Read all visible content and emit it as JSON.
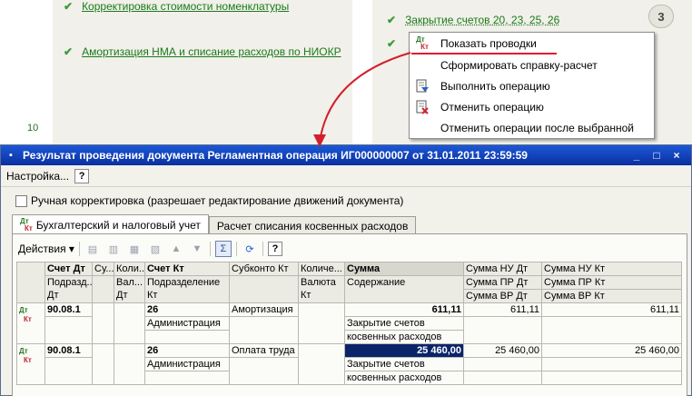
{
  "background": {
    "left_ops": [
      "Корректировка стоимости номенклатуры",
      "Амортизация НМА и списание расходов по НИОКР"
    ],
    "right_op": "Закрытие счетов 20, 23, 25, 26",
    "step_number": "3",
    "row_number": "10"
  },
  "context_menu": {
    "items": [
      {
        "label": "Показать проводки",
        "icon": "dt-kt-icon"
      },
      {
        "label": "Сформировать справку-расчет",
        "icon": ""
      },
      {
        "label": "Выполнить операцию",
        "icon": "execute-operation-icon"
      },
      {
        "label": "Отменить операцию",
        "icon": "cancel-operation-icon"
      },
      {
        "label": "Отменить операции после выбранной",
        "icon": ""
      }
    ],
    "accent": "#e0182d"
  },
  "window": {
    "title": "Результат проведения документа Регламентная операция ИГ000000007 от 31.01.2011 23:59:59",
    "settings_label": "Настройка...",
    "help_label": "?",
    "manual_adjust_label": "Ручная корректировка (разрешает редактирование движений документа)",
    "tabs": [
      "Бухгалтерский и налоговый учет",
      "Расчет списания косвенных расходов"
    ],
    "actions_label": "Действия",
    "title_buttons": [
      "_",
      "□",
      "×"
    ]
  },
  "grid": {
    "header_row1": [
      "Счет Дт",
      "Су...",
      "Коли...",
      "Счет Кт",
      "Субконто Кт",
      "Количе...",
      "Сумма",
      "Сумма НУ Дт",
      "Сумма НУ Кт"
    ],
    "header_row2": [
      "Подразд... Дт",
      "",
      "Вал... Дт",
      "Подразделение Кт",
      "",
      "Валюта Кт",
      "Содержание",
      "Сумма ПР Дт",
      "Сумма ПР Кт"
    ],
    "header_row3": [
      "Сумма ВР Дт",
      "Сумма ВР Кт"
    ],
    "rows": [
      {
        "dt": "90.08.1",
        "kt": "26",
        "subkonto_kt": "Амортизация",
        "dept_kt": "Администрация",
        "sum": "611,11",
        "content_1": "Закрытие счетов",
        "content_2": "косвенных расходов",
        "nu_dt": "611,11",
        "nu_kt": "611,11"
      },
      {
        "dt": "90.08.1",
        "kt": "26",
        "subkonto_kt": "Оплата труда",
        "dept_kt": "Администрация",
        "sum": "25 460,00",
        "content_1": "Закрытие счетов",
        "content_2": "косвенных расходов",
        "nu_dt": "25 460,00",
        "nu_kt": "25 460,00"
      }
    ]
  },
  "colors": {
    "title_bar": "#1c58d6",
    "link_green": "#1a7a1a",
    "selection": "#0a246a"
  }
}
